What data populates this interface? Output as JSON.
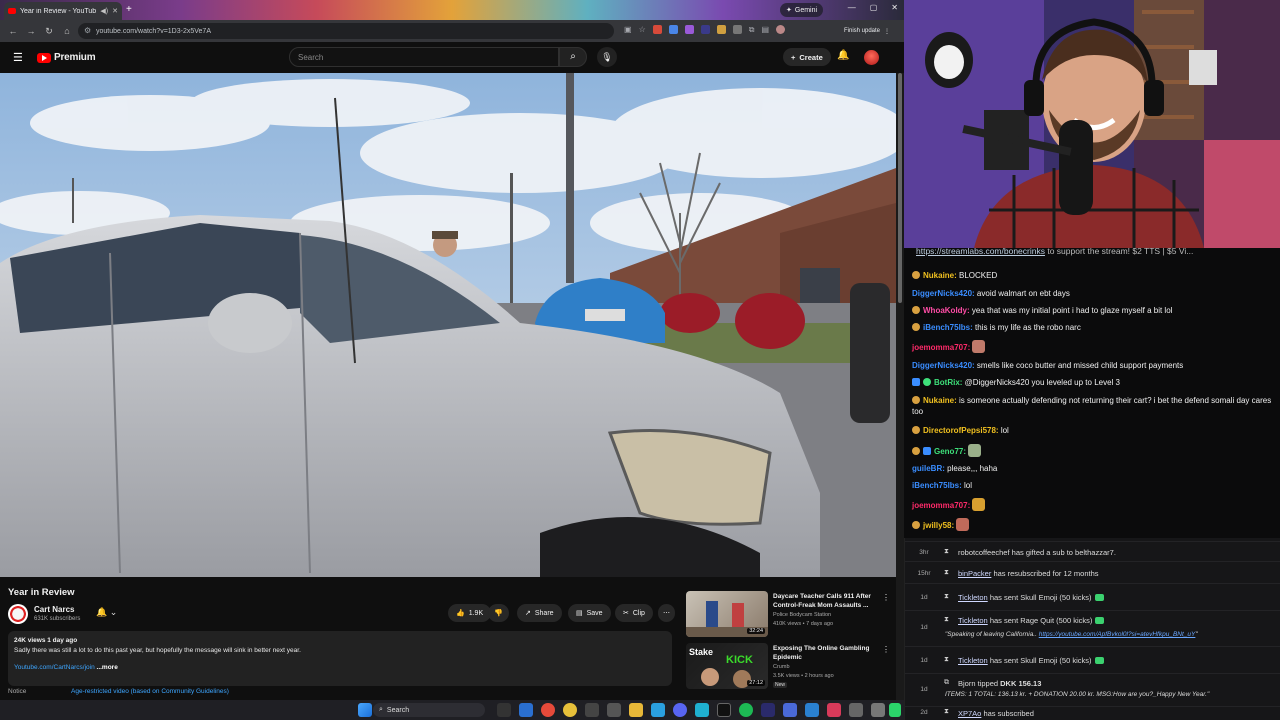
{
  "browser": {
    "tab_title": "Year in Review - YouTube",
    "new_tab_symbol": "+",
    "gemini_label": "Gemini",
    "url": "youtube.com/watch?v=1D3-2x5Ve7A",
    "finish_update": "Finish update"
  },
  "youtube": {
    "logo_text": "Premium",
    "search_placeholder": "Search",
    "create_label": "Create",
    "video": {
      "title": "Year in Review",
      "channel": "Cart Narcs",
      "subscribers": "631K subscribers",
      "likes": "1.9K",
      "share_label": "Share",
      "save_label": "Save",
      "clip_label": "Clip",
      "views_date": "24K views  1 day ago",
      "description": "Sadly there was still a lot to do this past year, but hopefully the message will sink in better next year.",
      "join_link": "Youtube.com/CartNarcs/join",
      "more_label": "...more",
      "notice_label": "Notice",
      "notice_link": "Age-restricted video (based on Community Guidelines)"
    },
    "recommendations": [
      {
        "title": "Daycare Teacher Calls 911 After Control-Freak Mom Assaults ...",
        "channel": "Police Bodycam Station",
        "meta": "410K views • 7 days ago",
        "duration": "32:24"
      },
      {
        "title": "Exposing The Online Gambling Epidemic",
        "channel": "Crumb",
        "meta": "3.5K views • 2 hours ago",
        "duration": "27:12",
        "badge": "New"
      }
    ]
  },
  "taskbar": {
    "search_label": "Search"
  },
  "chat": {
    "pinned": {
      "link": "https://streamlabs.com/bonecrinks",
      "text": " to support the stream! $2 TTS | $5 Vi..."
    },
    "messages": [
      {
        "user": "Nukaine:",
        "text": " BLOCKED",
        "color": "#f0c020"
      },
      {
        "user": "DiggerNicks420:",
        "text": " avoid walmart on ebt days",
        "color": "#3a8dff"
      },
      {
        "user": "WhoaKoldy:",
        "text": " yea that was my initial point i had to glaze myself a bit lol",
        "color": "#ff4da6"
      },
      {
        "user": "iBench75lbs:",
        "text": " this is my life as the robo narc",
        "color": "#3a8dff"
      },
      {
        "user": "joemomma707:",
        "text": "",
        "color": "#ff2a6a"
      },
      {
        "user": "DiggerNicks420:",
        "text": " smells like coco butter and missed child support payments",
        "color": "#3a8dff"
      },
      {
        "user": "BotRix:",
        "text": " @DiggerNicks420 you leveled up to Level 3",
        "color": "#3ee07a"
      },
      {
        "user": "Nukaine:",
        "text": " is someone actually defending not returning their cart? i bet the defend somali day cares too",
        "color": "#f0c020"
      },
      {
        "user": "DirectorofPepsi578:",
        "text": " lol",
        "color": "#f0c020"
      },
      {
        "user": "Geno77:",
        "text": "",
        "color": "#3ee07a"
      },
      {
        "user": "guileBR:",
        "text": " please,,,  haha",
        "color": "#3a8dff"
      },
      {
        "user": "iBench75lbs:",
        "text": " lol",
        "color": "#3a8dff"
      },
      {
        "user": "joemomma707:",
        "text": "",
        "color": "#ff2a6a"
      },
      {
        "user": "jwilly58:",
        "text": "",
        "color": "#f0c020"
      }
    ]
  },
  "events": [
    {
      "time": "3hr",
      "user": "robotcoffeechef",
      "text": " has gifted a sub to ",
      "target": "belthazzar7."
    },
    {
      "time": "15hr",
      "user": "binPacker",
      "text": " has resubscribed for 12 months"
    },
    {
      "time": "1d",
      "user": "Tickleton",
      "text": " has sent Skull Emoji (50 kicks)"
    },
    {
      "time": "1d",
      "user": "Tickleton",
      "text": " has sent Rage Quit (500 kicks)",
      "sub": "\"Speaking of leaving California..",
      "sub_link": "https://youtube.com/ApfBvkol0l?si=atevHfkpu_BNt_uY",
      "sub_end": "\""
    },
    {
      "time": "1d",
      "user": "Tickleton",
      "text": " has sent Skull Emoji (50 kicks)"
    },
    {
      "time": "1d",
      "user": "Bjorn",
      "text": " tipped ",
      "amount": "DKK 156.13",
      "sub": "ITEMS: 1 TOTAL: 136.13 kr. + DONATION 20.00 kr. MSG:How are you?_Happy New Year.\""
    },
    {
      "time": "2d",
      "user": "XP7Ao",
      "text": " has subscribed"
    }
  ]
}
